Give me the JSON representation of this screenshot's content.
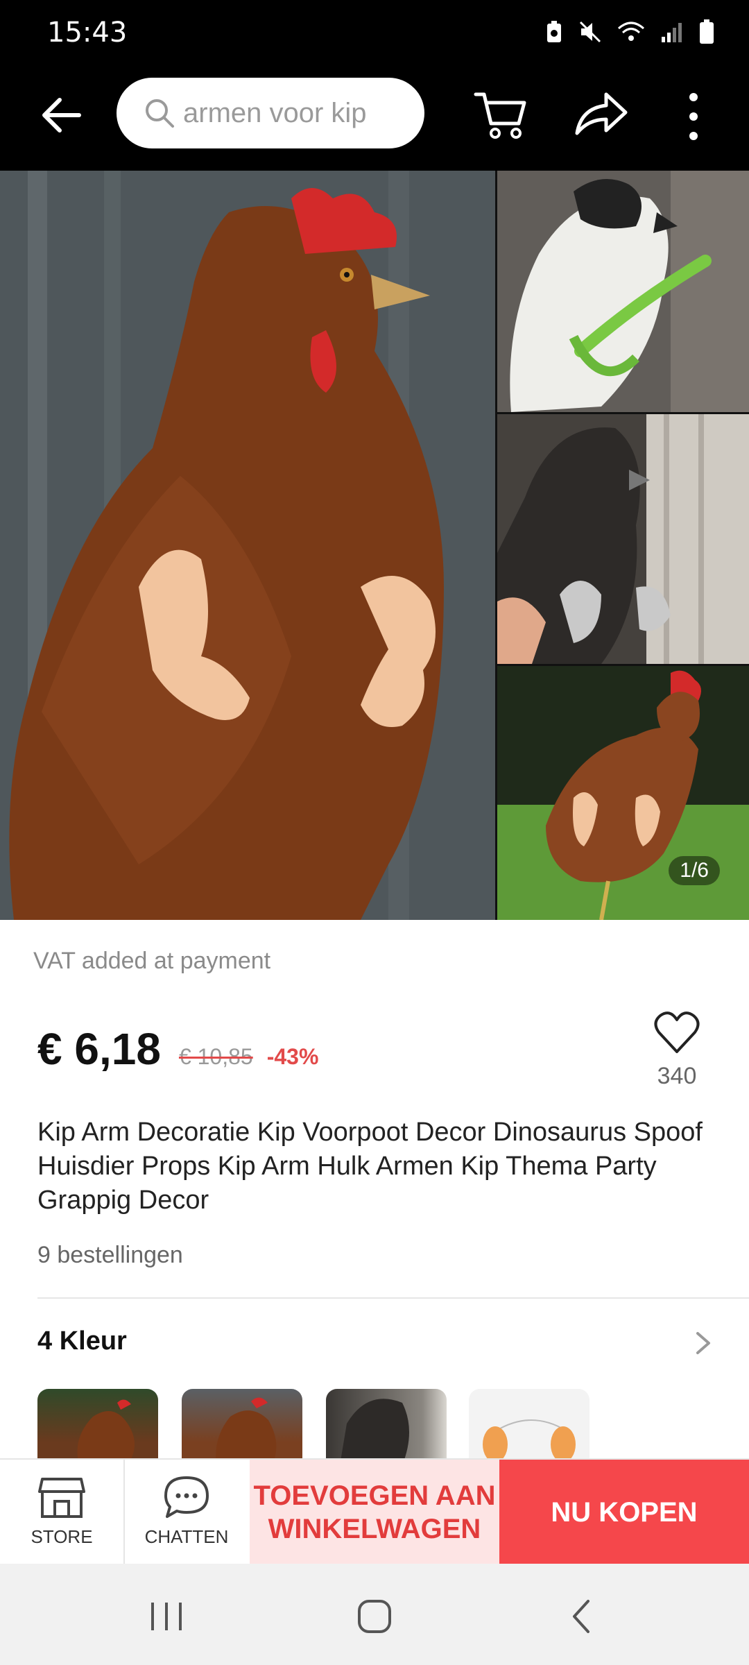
{
  "status_bar": {
    "time": "15:43",
    "icons": [
      "battery-saver-icon",
      "mute-icon",
      "wifi-icon",
      "signal-icon",
      "battery-icon"
    ]
  },
  "toolbar": {
    "search_placeholder": "armen voor kip",
    "icons": [
      "back-arrow-icon",
      "search-icon",
      "cart-icon",
      "share-icon",
      "more-vertical-icon"
    ]
  },
  "gallery": {
    "counter": "1/6"
  },
  "product": {
    "vat_note": "VAT added at payment",
    "price": "€ 6,18",
    "old_price": "€ 10,85",
    "discount": "-43%",
    "wishlist_count": "340",
    "title": "Kip Arm Decoratie Kip Voorpoot Decor Dinosaurus Spoof Huisdier Props Kip Arm Hulk Armen Kip Thema Party Grappig Decor",
    "orders": "9 bestellingen"
  },
  "variants": {
    "heading": "4 Kleur",
    "count": 4
  },
  "actions": {
    "store_label": "STORE",
    "chat_label": "CHATTEN",
    "add_to_cart_label": "TOEVOEGEN AAN WINKELWAGEN",
    "buy_now_label": "NU KOPEN"
  },
  "colors": {
    "accent_red": "#f5474b",
    "cart_bg": "#fde4e4",
    "discount_red": "#e24a4a"
  }
}
